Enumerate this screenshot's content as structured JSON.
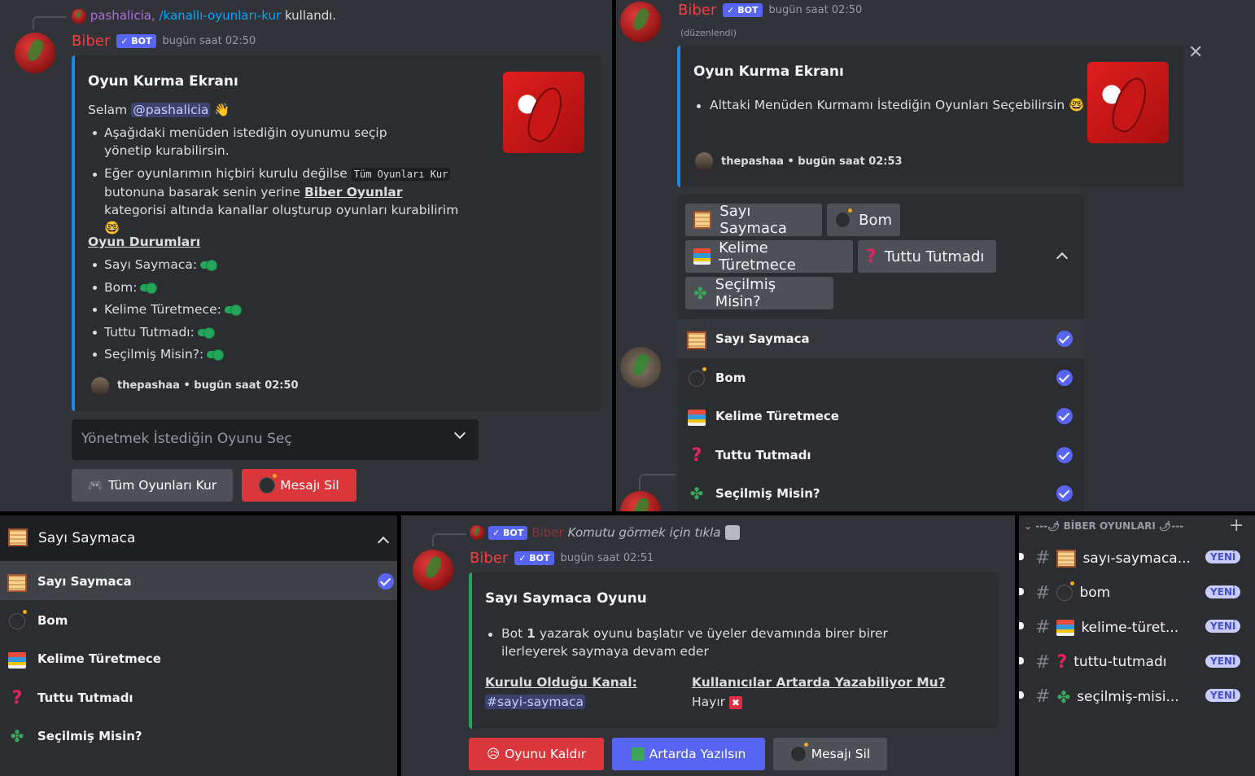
{
  "p1": {
    "reply": {
      "user": "pashalicia",
      "command": "/kanallı-oyunları-kur",
      "action": "kullandı."
    },
    "bot_name": "Biber",
    "badge": "✓ BOT",
    "timestamp": "bugün saat 02:50",
    "embed": {
      "title": "Oyun Kurma Ekranı",
      "greeting": "Selam",
      "mention": "@pashalicia",
      "wave": "👋",
      "bullet1": "Aşağıdaki menüden istediğin oyunumu seçip yönetip kurabilirsin.",
      "bullet2_a": "Eğer oyunlarımın hiçbiri kurulu değilse",
      "bullet2_code": "Tüm Oyunları Kur",
      "bullet2_b": "butonuna basarak senin yerine",
      "bullet2_bold": "Biber Oyunlar",
      "bullet2_c": "kategorisi altında kanallar oluşturup oyunları kurabilirim",
      "emoji_nerd": "🤓",
      "status_title": "Oyun Durumları",
      "statuses": [
        "Sayı Saymaca:",
        "Bom:",
        "Kelime Türetmece:",
        "Tuttu Tutmadı:",
        "Seçilmiş Misin?:"
      ],
      "footer_user": "thepashaa",
      "footer_sep": "•",
      "footer_time": "bugün saat 02:50"
    },
    "select_placeholder": "Yönetmek İstediğin Oyunu Seç",
    "btn_install": "Tüm Oyunları Kur",
    "btn_delete": "Mesajı Sil"
  },
  "p2": {
    "bot_name": "Biber",
    "badge": "✓ BOT",
    "timestamp": "bugün saat 02:50",
    "edited": "(düzenlendi)",
    "close": "✕",
    "embed": {
      "title": "Oyun Kurma Ekranı",
      "bullet1": "Alttaki Menüden Kurmamı İstediğin Oyunları Seçebilirsin",
      "emoji_nerd": "🤓",
      "footer_user": "thepashaa",
      "footer_sep": "•",
      "footer_time": "bugün saat 02:53"
    },
    "chips": [
      "Sayı Saymaca",
      "Bom",
      "Kelime Türetmece",
      "Tuttu Tutmadı",
      "Seçilmiş Misin?"
    ],
    "options": [
      "Sayı Saymaca",
      "Bom",
      "Kelime Türetmece",
      "Tuttu Tutmadı",
      "Seçilmiş Misin?"
    ]
  },
  "p3": {
    "selected": "Sayı Saymaca",
    "options": [
      "Sayı Saymaca",
      "Bom",
      "Kelime Türetmece",
      "Tuttu Tutmadı",
      "Seçilmiş Misin?"
    ]
  },
  "p4": {
    "reply_badge": "✓ BOT",
    "reply_name": "Biber",
    "reply_text": "Komutu görmek için tıkla",
    "bot_name": "Biber",
    "badge": "✓ BOT",
    "timestamp": "bugün saat 02:51",
    "embed": {
      "title": "Sayı Saymaca Oyunu",
      "bullet_a": "Bot",
      "bullet_bold": "1",
      "bullet_b": "yazarak oyunu başlatır ve üyeler devamında birer birer ilerleyerek saymaya devam eder",
      "field1_name": "Kurulu Olduğu Kanal:",
      "field1_value": "#sayi-saymaca",
      "field2_name": "Kullanıcılar Artarda Yazabiliyor Mu?",
      "field2_value": "Hayır",
      "field2_icon": "✖"
    },
    "btn_remove": "Oyunu Kaldır",
    "btn_allow": "Artarda Yazılsın",
    "btn_delete": "Mesajı Sil"
  },
  "p5": {
    "category": "---🌶 BİBER OYUNLARI 🌶---",
    "add": "+",
    "channels": [
      {
        "name": "sayı-saymaca...",
        "badge": "YENİ"
      },
      {
        "name": "bom",
        "badge": "YENİ"
      },
      {
        "name": "kelime-türet...",
        "badge": "YENİ"
      },
      {
        "name": "tuttu-tutmadı",
        "badge": "YENİ"
      },
      {
        "name": "seçilmiş-misi...",
        "badge": "YENİ"
      }
    ]
  },
  "colors": {
    "bg": "#313338",
    "embed": "#2b2d31",
    "blurple": "#5865f2",
    "red": "#da373c",
    "green": "#23a55a"
  }
}
